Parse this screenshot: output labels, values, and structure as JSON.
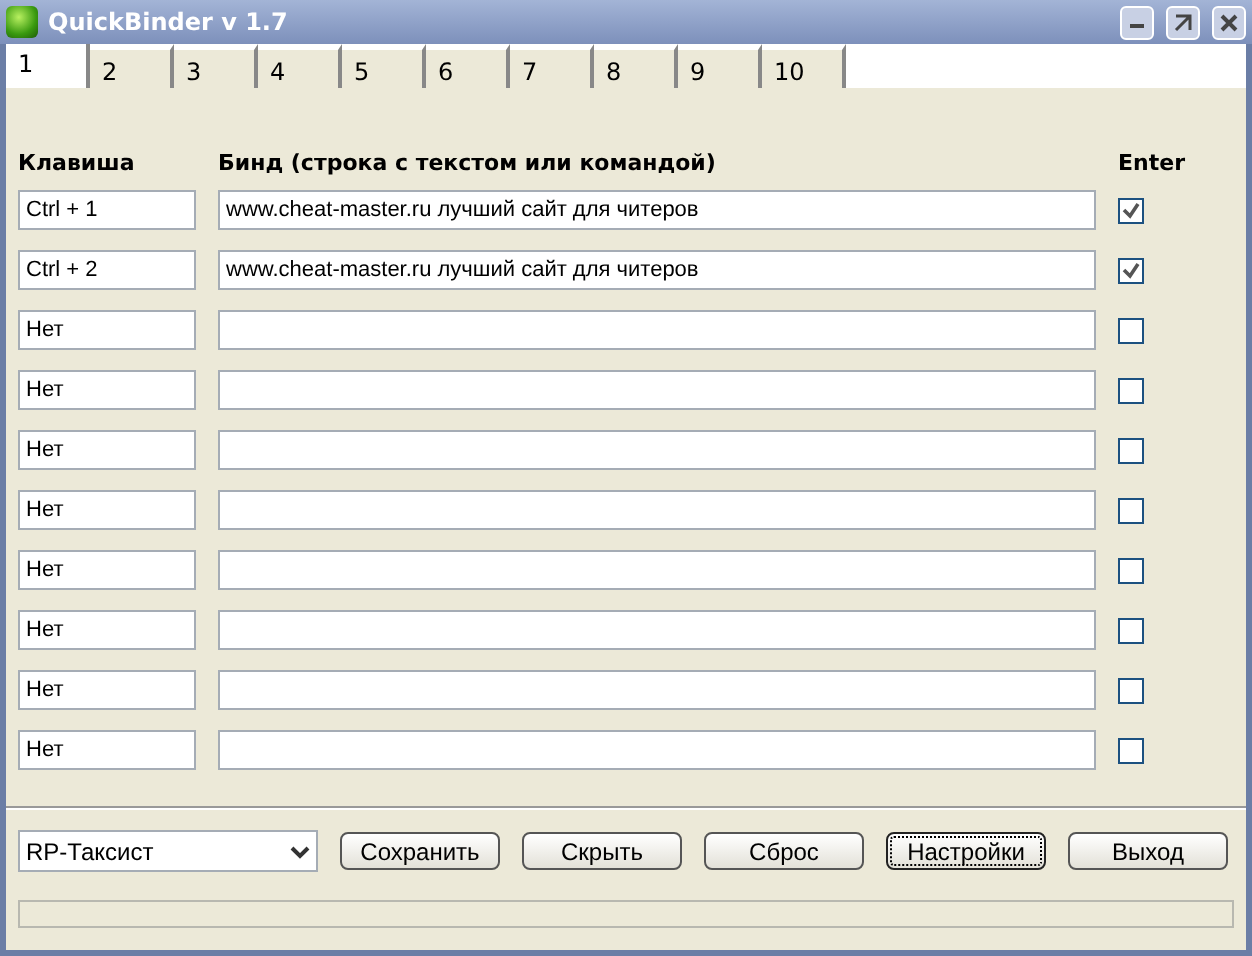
{
  "window": {
    "title": "QuickBinder v 1.7"
  },
  "tabs": [
    {
      "label": "1",
      "selected": true
    },
    {
      "label": "2",
      "selected": false
    },
    {
      "label": "3",
      "selected": false
    },
    {
      "label": "4",
      "selected": false
    },
    {
      "label": "5",
      "selected": false
    },
    {
      "label": "6",
      "selected": false
    },
    {
      "label": "7",
      "selected": false
    },
    {
      "label": "8",
      "selected": false
    },
    {
      "label": "9",
      "selected": false
    },
    {
      "label": "10",
      "selected": false
    }
  ],
  "headers": {
    "key": "Клавиша",
    "bind": "Бинд (строка с текстом или командой)",
    "enter": "Enter"
  },
  "rows": [
    {
      "key": "Ctrl + 1",
      "bind": "www.cheat-master.ru лучший сайт для читеров",
      "checked": true
    },
    {
      "key": "Ctrl + 2",
      "bind": "www.cheat-master.ru лучший сайт для читеров",
      "checked": true
    },
    {
      "key": "Нет",
      "checked": false
    },
    {
      "key": "Нет",
      "checked": false
    },
    {
      "key": "Нет",
      "checked": false
    },
    {
      "key": "Нет",
      "checked": false
    },
    {
      "key": "Нет",
      "checked": false
    },
    {
      "key": "Нет",
      "checked": false
    },
    {
      "key": "Нет",
      "checked": false
    },
    {
      "key": "Нет",
      "checked": false
    }
  ],
  "profile": {
    "value": "RP-Таксист"
  },
  "buttons": [
    {
      "label": "Сохранить",
      "focused": false
    },
    {
      "label": "Скрыть",
      "focused": false
    },
    {
      "label": "Сброс",
      "focused": false
    },
    {
      "label": "Настройки",
      "focused": true
    },
    {
      "label": "Выход",
      "focused": false
    }
  ],
  "progress": {
    "level": 0
  }
}
